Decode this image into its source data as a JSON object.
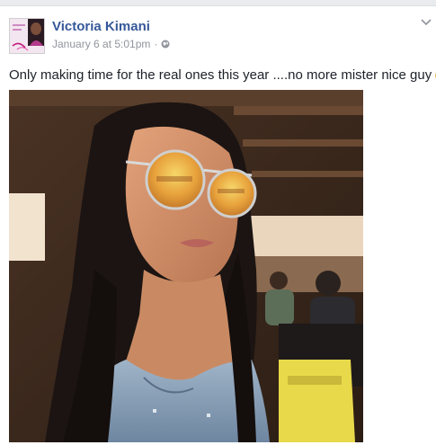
{
  "post": {
    "author": "Victoria Kimani",
    "timestamp": "January 6 at 5:01pm",
    "separator": "·",
    "audience_icon": "globe-icon",
    "options_icon": "chevron-down-icon",
    "message": "Only making time for the real ones this year ....no more mister nice guy",
    "emoji": "kiss-wink-emoji",
    "avatar_text": "Victoria Kimani",
    "photo_description_icon": "photo"
  },
  "colors": {
    "author_link": "#365899",
    "meta_text": "#90949c",
    "body_text": "#1d2129",
    "page_bg": "#e9ebee",
    "card_bg": "#ffffff"
  }
}
